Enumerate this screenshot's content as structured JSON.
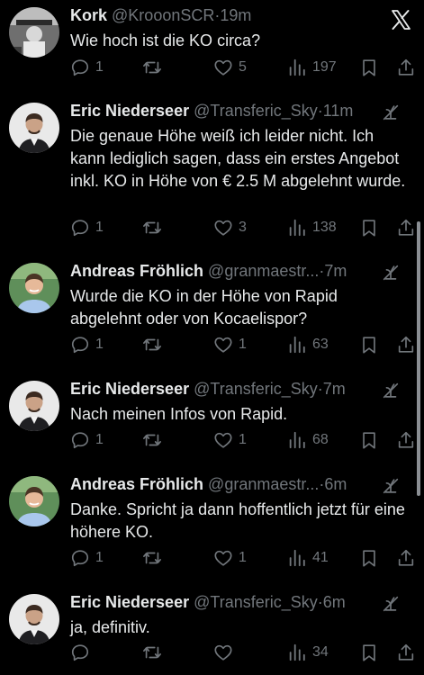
{
  "tweets": [
    {
      "name": "Kork",
      "handle": "@KrooonSCR",
      "sep": "·",
      "time": "19m",
      "text": "Wie hoch ist die KO circa?",
      "reply_count": "1",
      "repost_count": "",
      "like_count": "5",
      "view_count": "197",
      "avatar": "black-white-photo-avatar",
      "top_right_icon": "x-logo-icon"
    },
    {
      "name": "Eric Niederseer",
      "handle": "@Transferic_Sky",
      "sep": "·",
      "time": "11m",
      "text": "Die genaue Höhe weiß ich leider nicht. Ich kann lediglich sagen, dass ein erstes Angebot inkl. KO in Höhe von € 2.5 M abgelehnt wurde.",
      "reply_count": "1",
      "repost_count": "",
      "like_count": "3",
      "view_count": "138",
      "avatar": "man-in-suit-avatar",
      "top_right_icon": "hide-reply-icon"
    },
    {
      "name": "Andreas Fröhlich",
      "handle": "@granmaestr...",
      "sep": "·",
      "time": "7m",
      "text": "Wurde die KO in der Höhe von Rapid abgelehnt oder von Kocaelispor?",
      "reply_count": "1",
      "repost_count": "",
      "like_count": "1",
      "view_count": "63",
      "avatar": "smiling-man-avatar",
      "top_right_icon": "hide-reply-icon"
    },
    {
      "name": "Eric Niederseer",
      "handle": "@Transferic_Sky",
      "sep": "·",
      "time": "7m",
      "text": "Nach meinen Infos von Rapid.",
      "reply_count": "1",
      "repost_count": "",
      "like_count": "1",
      "view_count": "68",
      "avatar": "man-in-suit-avatar",
      "top_right_icon": "hide-reply-icon"
    },
    {
      "name": "Andreas Fröhlich",
      "handle": "@granmaestr...",
      "sep": "·",
      "time": "6m",
      "text": "Danke. Spricht ja dann hoffentlich jetzt für eine höhere KO.",
      "reply_count": "1",
      "repost_count": "",
      "like_count": "1",
      "view_count": "41",
      "avatar": "smiling-man-avatar",
      "top_right_icon": "hide-reply-icon"
    },
    {
      "name": "Eric Niederseer",
      "handle": "@Transferic_Sky",
      "sep": "·",
      "time": "6m",
      "text": "ja, definitiv.",
      "reply_count": "",
      "repost_count": "",
      "like_count": "",
      "view_count": "34",
      "avatar": "man-in-suit-avatar",
      "top_right_icon": "hide-reply-icon"
    }
  ],
  "colors": {
    "background": "#000000",
    "primary_text": "#e7e9ea",
    "secondary_text": "#71767b"
  }
}
